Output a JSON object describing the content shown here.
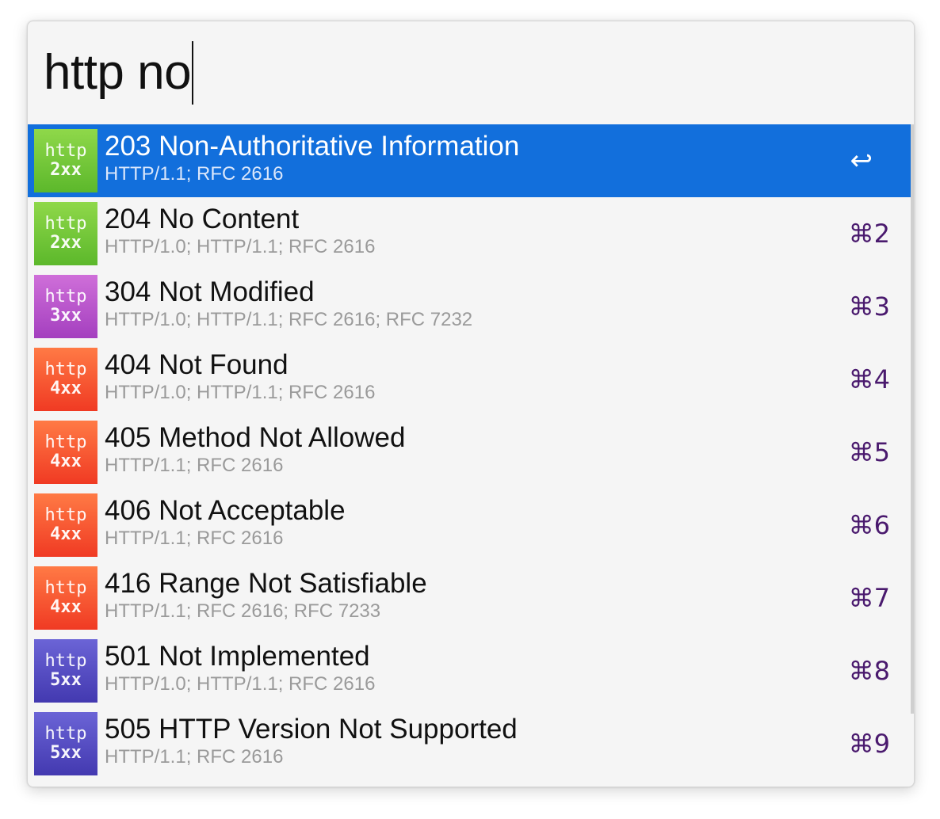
{
  "search": {
    "query": "http no"
  },
  "results": [
    {
      "badge_top": "http",
      "badge_bottom": "2xx",
      "title": "203 Non-Authoritative Information",
      "subtitle": "HTTP/1.1; RFC 2616",
      "shortcut": "↩",
      "selected": true,
      "badge_color": "#6cc634"
    },
    {
      "badge_top": "http",
      "badge_bottom": "2xx",
      "title": "204 No Content",
      "subtitle": "HTTP/1.0; HTTP/1.1; RFC 2616",
      "shortcut": "⌘2",
      "badge_color": "#6cc634"
    },
    {
      "badge_top": "http",
      "badge_bottom": "3xx",
      "title": "304 Not Modified",
      "subtitle": "HTTP/1.0; HTTP/1.1; RFC 2616; RFC 7232",
      "shortcut": "⌘3",
      "badge_color": "#b954cc"
    },
    {
      "badge_top": "http",
      "badge_bottom": "4xx",
      "title": "404 Not Found",
      "subtitle": "HTTP/1.0; HTTP/1.1; RFC 2616",
      "shortcut": "⌘4",
      "badge_color": "#f55a32"
    },
    {
      "badge_top": "http",
      "badge_bottom": "4xx",
      "title": "405 Method Not Allowed",
      "subtitle": "HTTP/1.1; RFC 2616",
      "shortcut": "⌘5",
      "badge_color": "#f55a32"
    },
    {
      "badge_top": "http",
      "badge_bottom": "4xx",
      "title": "406 Not Acceptable",
      "subtitle": "HTTP/1.1; RFC 2616",
      "shortcut": "⌘6",
      "badge_color": "#f55a32"
    },
    {
      "badge_top": "http",
      "badge_bottom": "4xx",
      "title": "416 Range Not Satisfiable",
      "subtitle": "HTTP/1.1; RFC 2616; RFC 7233",
      "shortcut": "⌘7",
      "badge_color": "#f55a32"
    },
    {
      "badge_top": "http",
      "badge_bottom": "5xx",
      "title": "501 Not Implemented",
      "subtitle": "HTTP/1.0; HTTP/1.1; RFC 2616",
      "shortcut": "⌘8",
      "badge_color": "#564ec4"
    },
    {
      "badge_top": "http",
      "badge_bottom": "5xx",
      "title": "505 HTTP Version Not Supported",
      "subtitle": "HTTP/1.1; RFC 2616",
      "shortcut": "⌘9",
      "badge_color": "#564ec4"
    }
  ],
  "colors": {
    "selection": "#126fdc",
    "shortcut": "#4a1a6e",
    "background": "#f5f5f5"
  }
}
